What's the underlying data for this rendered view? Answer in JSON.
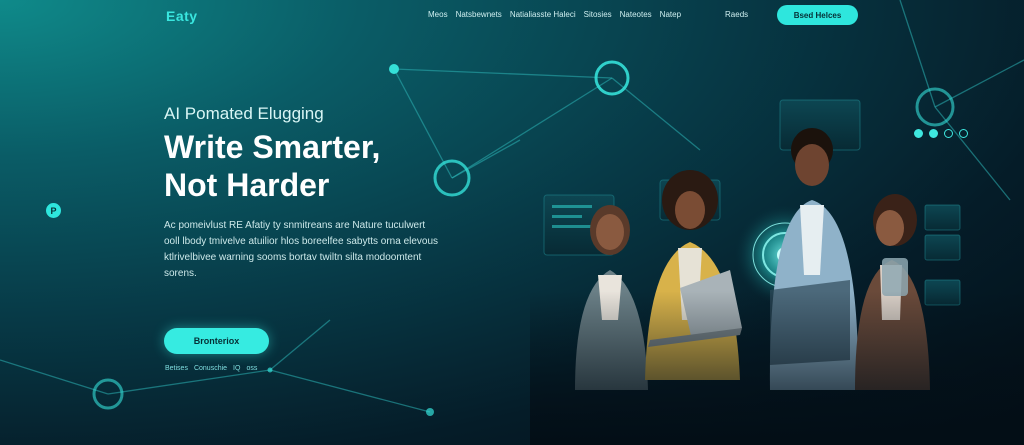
{
  "header": {
    "logo": "Eaty",
    "nav": [
      "Meos",
      "Natsbewnets",
      "Natialiasste Haleci",
      "Sitosies",
      "Nateotes",
      "Natep"
    ],
    "nav_extra": "Raeds",
    "cta_label": "Bsed Helces"
  },
  "hero": {
    "eyebrow": "AI Pomated Elugging",
    "headline_line1": "Write Smarter,",
    "headline_line2": "Not Harder",
    "description": "Ac pomeivlust RE Afatiy ty snmitreans are Nature tuculwert ooll lbody tmivelve atuilior hlos boreelfee sabytts orna elevous ktlrivelbivee warning sooms bortav twiltn silta modoomtent sorens.",
    "cta_label": "Bronteriox",
    "sublinks": [
      "Betises",
      "Conuschie",
      "IQ",
      "oss"
    ]
  },
  "side_badge": "P",
  "colors": {
    "accent": "#2ee6dd",
    "bg_dark": "#030e16",
    "bg_teal": "#0f8a8a"
  }
}
